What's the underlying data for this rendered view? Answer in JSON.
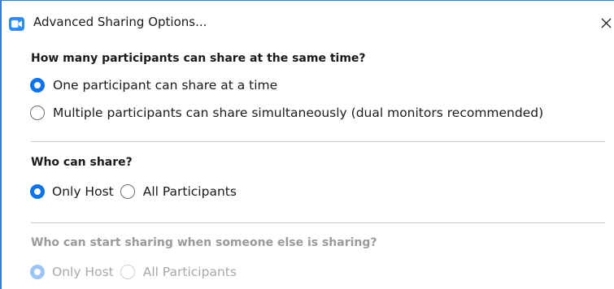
{
  "window": {
    "title": "Advanced Sharing Options..."
  },
  "icons": {
    "app": "zoom-app-icon",
    "close": "close-icon"
  },
  "colors": {
    "accent": "#0e72ed",
    "window_border": "#3b7bd8",
    "disabled_text": "#9a9a9a"
  },
  "sections": [
    {
      "title": "How many participants can share at the same time?",
      "disabled": false,
      "options": [
        {
          "label": "One participant can share at a time",
          "checked": true
        },
        {
          "label": "Multiple participants can share simultaneously (dual monitors recommended)",
          "checked": false
        }
      ]
    },
    {
      "title": "Who can share?",
      "disabled": false,
      "options": [
        {
          "label": "Only Host",
          "checked": true
        },
        {
          "label": "All Participants",
          "checked": false
        }
      ]
    },
    {
      "title": "Who can start sharing when someone else is sharing?",
      "disabled": true,
      "options": [
        {
          "label": "Only Host",
          "checked": true
        },
        {
          "label": "All Participants",
          "checked": false
        }
      ]
    }
  ]
}
